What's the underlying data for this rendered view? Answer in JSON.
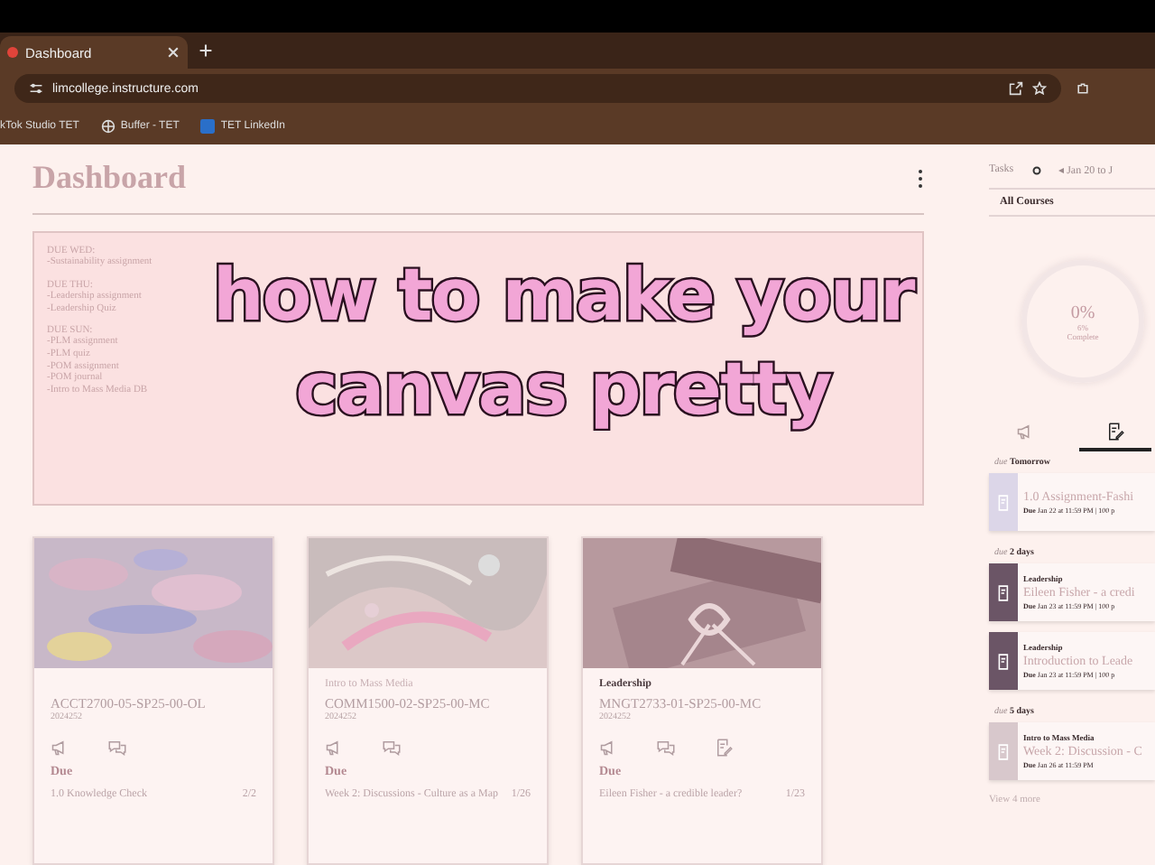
{
  "browser": {
    "tab": {
      "title": "Dashboard",
      "selected": true
    },
    "address": "limcollege.instructure.com",
    "bookmarks": [
      {
        "label": "kTok Studio TET",
        "kind": "plain"
      },
      {
        "label": "Buffer - TET",
        "kind": "globe"
      },
      {
        "label": "TET LinkedIn",
        "kind": "linkedin"
      }
    ]
  },
  "page": {
    "title": "Dashboard",
    "notes": [
      {
        "heading": "DUE WED:",
        "items": [
          "-Sustainability assignment"
        ]
      },
      {
        "heading": "DUE THU:",
        "items": [
          "-Leadership assignment",
          "-Leadership Quiz"
        ]
      },
      {
        "heading": "DUE SUN:",
        "items": [
          "-PLM assignment",
          "-PLM quiz",
          "-POM assignment",
          "-POM journal",
          "-Intro to Mass Media DB"
        ]
      }
    ],
    "caption": [
      "how to make your",
      "canvas pretty"
    ],
    "cards": [
      {
        "kind": "picture",
        "code": "ACCT2700-05-SP25-00-OL",
        "term": "2024252",
        "icons": [
          {
            "kind": "announcement"
          },
          {
            "kind": "discussion"
          }
        ],
        "due_label": "Due",
        "due_item": "1.0 Knowledge Check",
        "due_count": "2/2"
      },
      {
        "kind": "picture",
        "course": "Intro to Mass Media",
        "bold": false,
        "code": "COMM1500-02-SP25-00-MC",
        "term": "2024252",
        "icons": [
          {
            "kind": "announcement"
          },
          {
            "kind": "discussion"
          }
        ],
        "due_label": "Due",
        "due_item": "Week 2: Discussions - Culture as a Map",
        "due_count": "1/26"
      },
      {
        "kind": "picture",
        "course": "Leadership",
        "bold": true,
        "code": "MNGT2733-01-SP25-00-MC",
        "term": "2024252",
        "icons": [
          {
            "kind": "announcement"
          },
          {
            "kind": "discussion"
          },
          {
            "kind": "assignment"
          }
        ],
        "due_label": "Due",
        "due_item": "Eileen Fisher - a credible leader?",
        "due_count": "1/23"
      }
    ]
  },
  "sidebar": {
    "tasks_label": "Tasks",
    "date_range": "◂ Jan 20 to J",
    "filter": "All Courses",
    "progress": {
      "percent": "0%",
      "detail": "6%",
      "label": "Complete"
    },
    "tabs": [
      {
        "kind": "announcement",
        "selected": false
      },
      {
        "kind": "assignment",
        "selected": true
      }
    ],
    "groups": [
      {
        "label": "due",
        "when": "Tomorrow",
        "items": [
          {
            "title": "1.0 Assignment-Fashi",
            "due_label": "Due",
            "due": "Jan 22 at 11:59 PM | 100 p",
            "color": "#dcd6e8"
          }
        ]
      },
      {
        "label": "due",
        "when": "2 days",
        "items": [
          {
            "course": "Leadership",
            "title": "Eileen Fisher - a credi",
            "due_label": "Due",
            "due": "Jan 23 at 11:59 PM | 100 p",
            "color": "#6b5566"
          },
          {
            "course": "Leadership",
            "title": "Introduction to Leade",
            "due_label": "Due",
            "due": "Jan 23 at 11:59 PM | 100 p",
            "color": "#6b5566"
          }
        ]
      },
      {
        "label": "due",
        "when": "5 days",
        "items": [
          {
            "course": "Intro to Mass Media",
            "title": "Week 2: Discussion - C",
            "due_label": "Due",
            "due": "Jan 26 at 11:59 PM",
            "color": "#d8c8cc"
          }
        ]
      }
    ],
    "more": "View 4 more"
  }
}
